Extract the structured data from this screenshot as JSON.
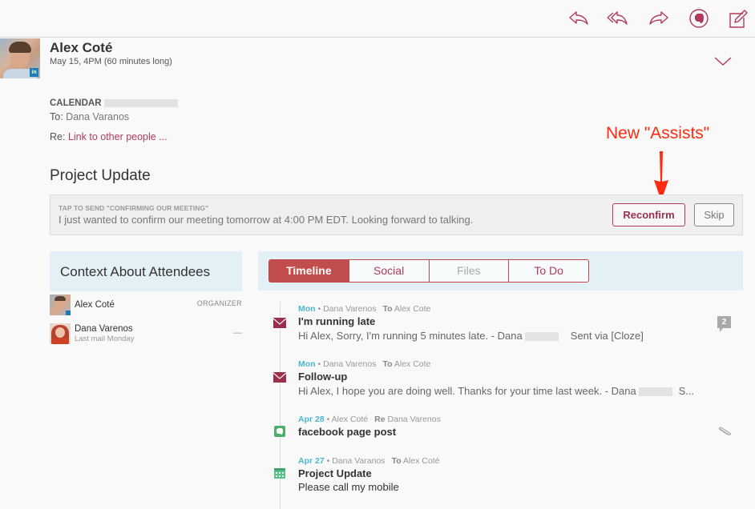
{
  "toolbar": {
    "icons": [
      "reply-icon",
      "reply-all-icon",
      "forward-icon",
      "evernote-icon",
      "compose-icon"
    ],
    "accent_color": "#b03a5b"
  },
  "contact": {
    "name": "Alex Coté",
    "subtitle": "May 15, 4PM (60 minutes long)",
    "badge": "in"
  },
  "meta": {
    "calendar_label": "CALENDAR",
    "to_label": "To:",
    "to_value": "Dana Varanos",
    "re_label": "Re:",
    "re_link": "Link to other people ..."
  },
  "subject": "Project Update",
  "assist": {
    "label": "TAP TO SEND \"CONFIRMING OUR MEETING\"",
    "text": "I just wanted to confirm our meeting tomorrow at 4:00 PM EDT. Looking forward to talking.",
    "reconfirm_label": "Reconfirm",
    "skip_label": "Skip"
  },
  "annotation": {
    "text": "New \"Assists\"",
    "color": "#ff2a0f"
  },
  "attendees": {
    "title": "Context About Attendees",
    "people": [
      {
        "name": "Alex Coté",
        "role": "ORGANIZER",
        "sub": ""
      },
      {
        "name": "Dana Varenos",
        "role": "—",
        "sub": "Last mail Monday"
      }
    ]
  },
  "tabs": [
    {
      "label": "Timeline",
      "state": "active"
    },
    {
      "label": "Social",
      "state": "normal"
    },
    {
      "label": "Files",
      "state": "disabled"
    },
    {
      "label": "To Do",
      "state": "normal"
    }
  ],
  "timeline": [
    {
      "icon": "mail-icon",
      "date": "Mon",
      "from": "Dana Varenos",
      "relation": "To",
      "to": "Alex Cote",
      "title": "I'm running late",
      "body_before": "Hi Alex, Sorry, I'm running 5 minutes late. - Dana",
      "body_after": "Sent via [Cloze]",
      "comment_count": "2"
    },
    {
      "icon": "mail-icon",
      "date": "Mon",
      "from": "Dana Varenos",
      "relation": "To",
      "to": "Alex Cote",
      "title": "Follow-up",
      "body_before": "Hi Alex, I hope you are doing well. Thanks for your time last week. - Dana",
      "body_after": "S..."
    },
    {
      "icon": "evernote-note-icon",
      "date": "Apr 28",
      "from": "Alex Coté",
      "relation": "Re",
      "to": "Dana Varenos",
      "title": "facebook page post"
    },
    {
      "icon": "calendar-icon",
      "date": "Apr 27",
      "from": "Dana Varanos",
      "relation": "To",
      "to": "Alex Coté",
      "title": "Project Update",
      "body": "Please call my mobile"
    }
  ]
}
